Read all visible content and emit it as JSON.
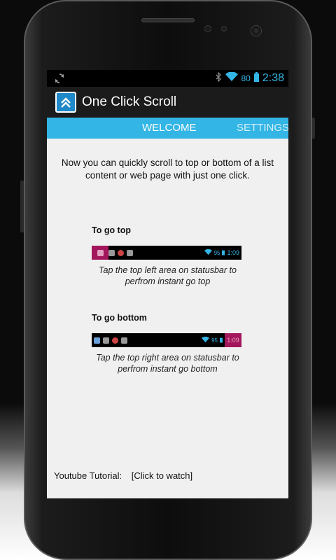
{
  "status_bar": {
    "battery_percent": "80",
    "time": "2:38",
    "icons": [
      "sync-icon",
      "bluetooth-icon",
      "wifi-icon",
      "battery-icon"
    ]
  },
  "app_bar": {
    "title": "One Click Scroll",
    "icon": "double-chevron-up-icon"
  },
  "tabs": [
    {
      "label": "WELCOME",
      "active": true
    },
    {
      "label": "SETTINGS",
      "active": false
    }
  ],
  "welcome": {
    "intro": "Now you can quickly scroll to top or bottom of a list content or web page with just one click.",
    "go_top": {
      "title": "To go top",
      "caption_line1": "Tap the top left area on statusbar to",
      "caption_line2": "perfrom instant go top",
      "battery": "95",
      "time": "1:09"
    },
    "go_bottom": {
      "title": "To go bottom",
      "caption_line1": "Tap the top right area on statusbar to",
      "caption_line2": "perfrom instant go bottom",
      "battery": "95",
      "time": "1:09"
    },
    "youtube_label": "Youtube Tutorial:",
    "youtube_link": "[Click to watch]"
  },
  "colors": {
    "accent": "#33b5e5",
    "highlight": "#a3165c",
    "action_bar": "#1b1b1b"
  }
}
